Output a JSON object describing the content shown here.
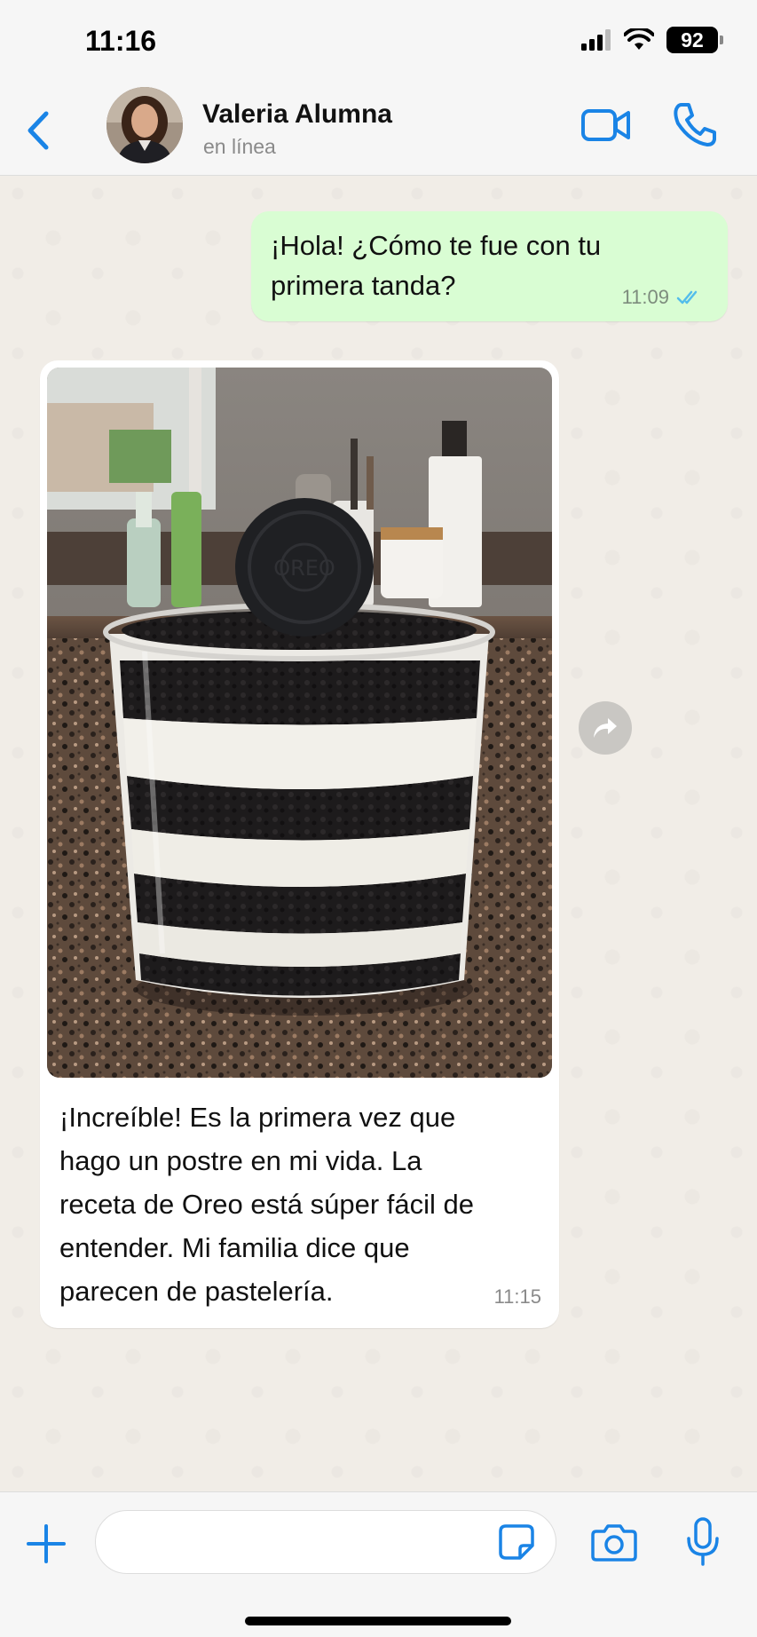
{
  "status_bar": {
    "time": "11:16",
    "battery": "92"
  },
  "header": {
    "contact_name": "Valeria Alumna",
    "contact_status": "en línea"
  },
  "messages": [
    {
      "direction": "outgoing",
      "text": "¡Hola! ¿Cómo te fue con tu primera tanda?",
      "time": "11:09",
      "status": "read"
    },
    {
      "direction": "incoming",
      "image": "photo of layered Oreo dessert cup",
      "text": "¡Increíble! Es la primera vez que hago un postre en mi vida. La receta de Oreo está súper fácil de entender. Mi familia dice que parecen de pastelería.",
      "time": "11:15"
    }
  ],
  "input": {
    "placeholder": ""
  },
  "icons": {
    "back": "chevron-left-icon",
    "video": "video-camera-icon",
    "call": "phone-icon",
    "forward": "forward-arrow-icon",
    "plus": "plus-icon",
    "sticker": "sticker-icon",
    "camera": "camera-icon",
    "mic": "microphone-icon"
  },
  "colors": {
    "accent": "#1a84e6",
    "outgoing_bubble": "#d9fdd3",
    "incoming_bubble": "#ffffff",
    "read_ticks": "#53bdeb",
    "chat_background": "#f1ede7"
  }
}
